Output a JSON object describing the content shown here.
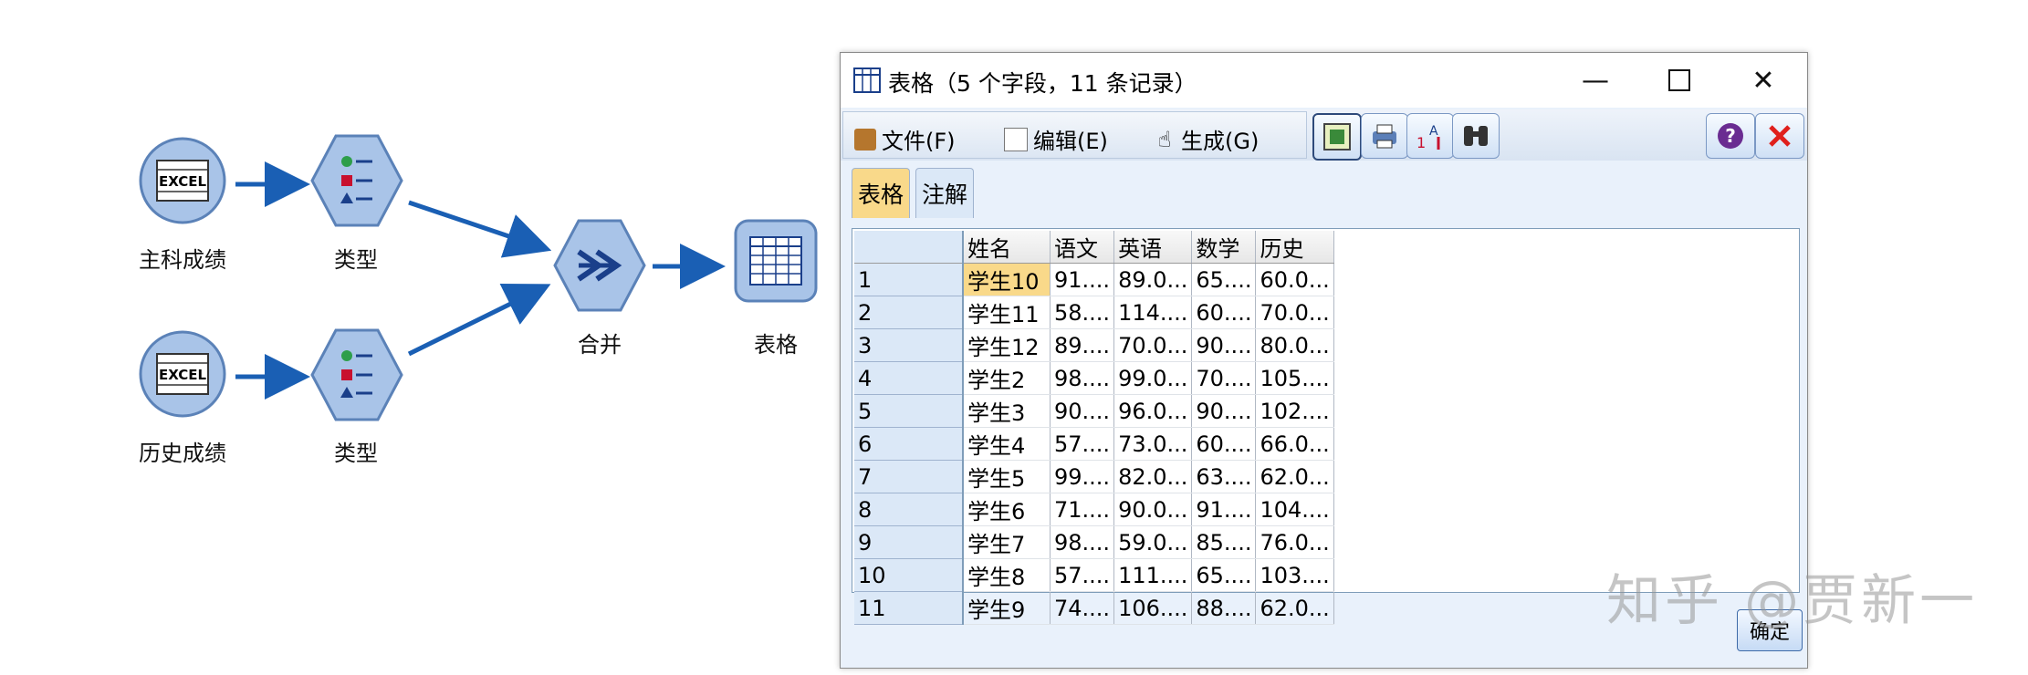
{
  "flow": {
    "nodes": [
      {
        "id": "main-scores",
        "label": "主科成绩",
        "icon": "excel-icon",
        "icon_text": "EXCEL"
      },
      {
        "id": "type-1",
        "label": "类型",
        "icon": "type-node-icon"
      },
      {
        "id": "history-scores",
        "label": "历史成绩",
        "icon": "excel-icon",
        "icon_text": "EXCEL"
      },
      {
        "id": "type-2",
        "label": "类型",
        "icon": "type-node-icon"
      },
      {
        "id": "merge",
        "label": "合并",
        "icon": "merge-icon"
      },
      {
        "id": "table",
        "label": "表格",
        "icon": "table-icon"
      }
    ]
  },
  "dialog": {
    "title": "表格（5 个字段，11 条记录）",
    "window_icon": "table-icon",
    "menus": [
      {
        "label": "文件(F)",
        "icon": "file-icon"
      },
      {
        "label": "编辑(E)",
        "icon": "edit-icon"
      },
      {
        "label": "生成(G)",
        "icon": "generate-icon"
      }
    ],
    "toolbar": [
      "insert-node-icon",
      "print-icon",
      "sort-icon",
      "find-icon"
    ],
    "right_tools": [
      "help-icon",
      "close-red-icon"
    ],
    "tabs": [
      {
        "label": "表格",
        "active": true
      },
      {
        "label": "注解",
        "active": false
      }
    ],
    "table": {
      "columns": [
        "姓名",
        "语文",
        "英语",
        "数学",
        "历史"
      ],
      "rows": [
        {
          "n": "1",
          "cells": [
            "学生10",
            "91....",
            "89.0...",
            "65....",
            "60.0..."
          ]
        },
        {
          "n": "2",
          "cells": [
            "学生11",
            "58....",
            "114....",
            "60....",
            "70.0..."
          ]
        },
        {
          "n": "3",
          "cells": [
            "学生12",
            "89....",
            "70.0...",
            "90....",
            "80.0..."
          ]
        },
        {
          "n": "4",
          "cells": [
            "学生2",
            "98....",
            "99.0...",
            "70....",
            "105...."
          ]
        },
        {
          "n": "5",
          "cells": [
            "学生3",
            "90....",
            "96.0...",
            "90....",
            "102...."
          ]
        },
        {
          "n": "6",
          "cells": [
            "学生4",
            "57....",
            "73.0...",
            "60....",
            "66.0..."
          ]
        },
        {
          "n": "7",
          "cells": [
            "学生5",
            "99....",
            "82.0...",
            "63....",
            "62.0..."
          ]
        },
        {
          "n": "8",
          "cells": [
            "学生6",
            "71....",
            "90.0...",
            "91....",
            "104...."
          ]
        },
        {
          "n": "9",
          "cells": [
            "学生7",
            "98....",
            "59.0...",
            "85....",
            "76.0..."
          ]
        },
        {
          "n": "10",
          "cells": [
            "学生8",
            "57....",
            "111....",
            "65....",
            "103...."
          ]
        },
        {
          "n": "11",
          "cells": [
            "学生9",
            "74....",
            "106....",
            "88....",
            "62.0..."
          ]
        }
      ]
    },
    "ok_label": "确定"
  },
  "watermark": "知乎 @贾新一",
  "colors": {
    "node_fill": "#a9c4e8",
    "arrow": "#1a5fb4",
    "selected_cell": "#f9d98a",
    "active_tab": "#f9d98a"
  }
}
